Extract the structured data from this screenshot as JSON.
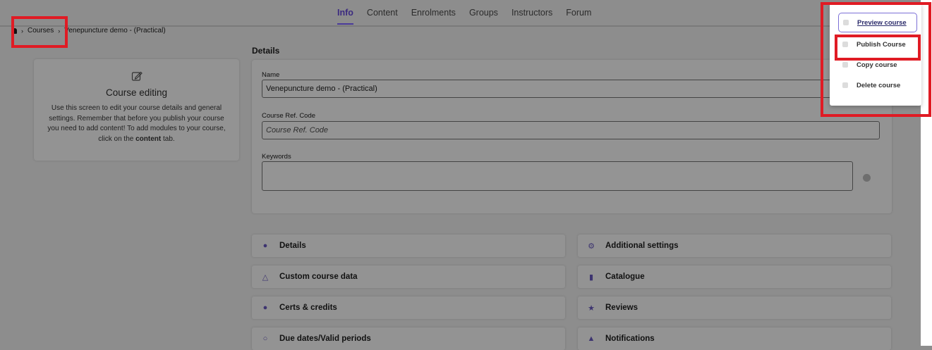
{
  "tabs": [
    {
      "label": "Info",
      "active": true
    },
    {
      "label": "Content"
    },
    {
      "label": "Enrolments"
    },
    {
      "label": "Groups"
    },
    {
      "label": "Instructors"
    },
    {
      "label": "Forum"
    }
  ],
  "breadcrumb": {
    "courses": "Courses",
    "current": "Venepuncture demo - (Practical)"
  },
  "info_card": {
    "title": "Course editing",
    "desc_pre": "Use this screen to edit your course details and general settings. Remember that before you publish your course you need to add content! To add modules to your course, click on the ",
    "desc_bold": "content",
    "desc_post": " tab."
  },
  "details": {
    "section_title": "Details",
    "name_label": "Name",
    "name_value": "Venepuncture demo - (Practical)",
    "ref_label": "Course Ref. Code",
    "ref_placeholder": "Course Ref. Code",
    "keywords_label": "Keywords"
  },
  "accordion": {
    "left": [
      "Details",
      "Custom course data",
      "Certs & credits",
      "Due dates/Valid periods"
    ],
    "right": [
      "Additional settings",
      "Catalogue",
      "Reviews",
      "Notifications"
    ]
  },
  "dropdown": {
    "preview": "Preview course",
    "publish": "Publish Course",
    "copy": "Copy course",
    "delete": "Delete course"
  },
  "colors": {
    "highlight": "#e01b24",
    "active_tab": "#3b2a80",
    "accent_icon": "#3d3470"
  }
}
